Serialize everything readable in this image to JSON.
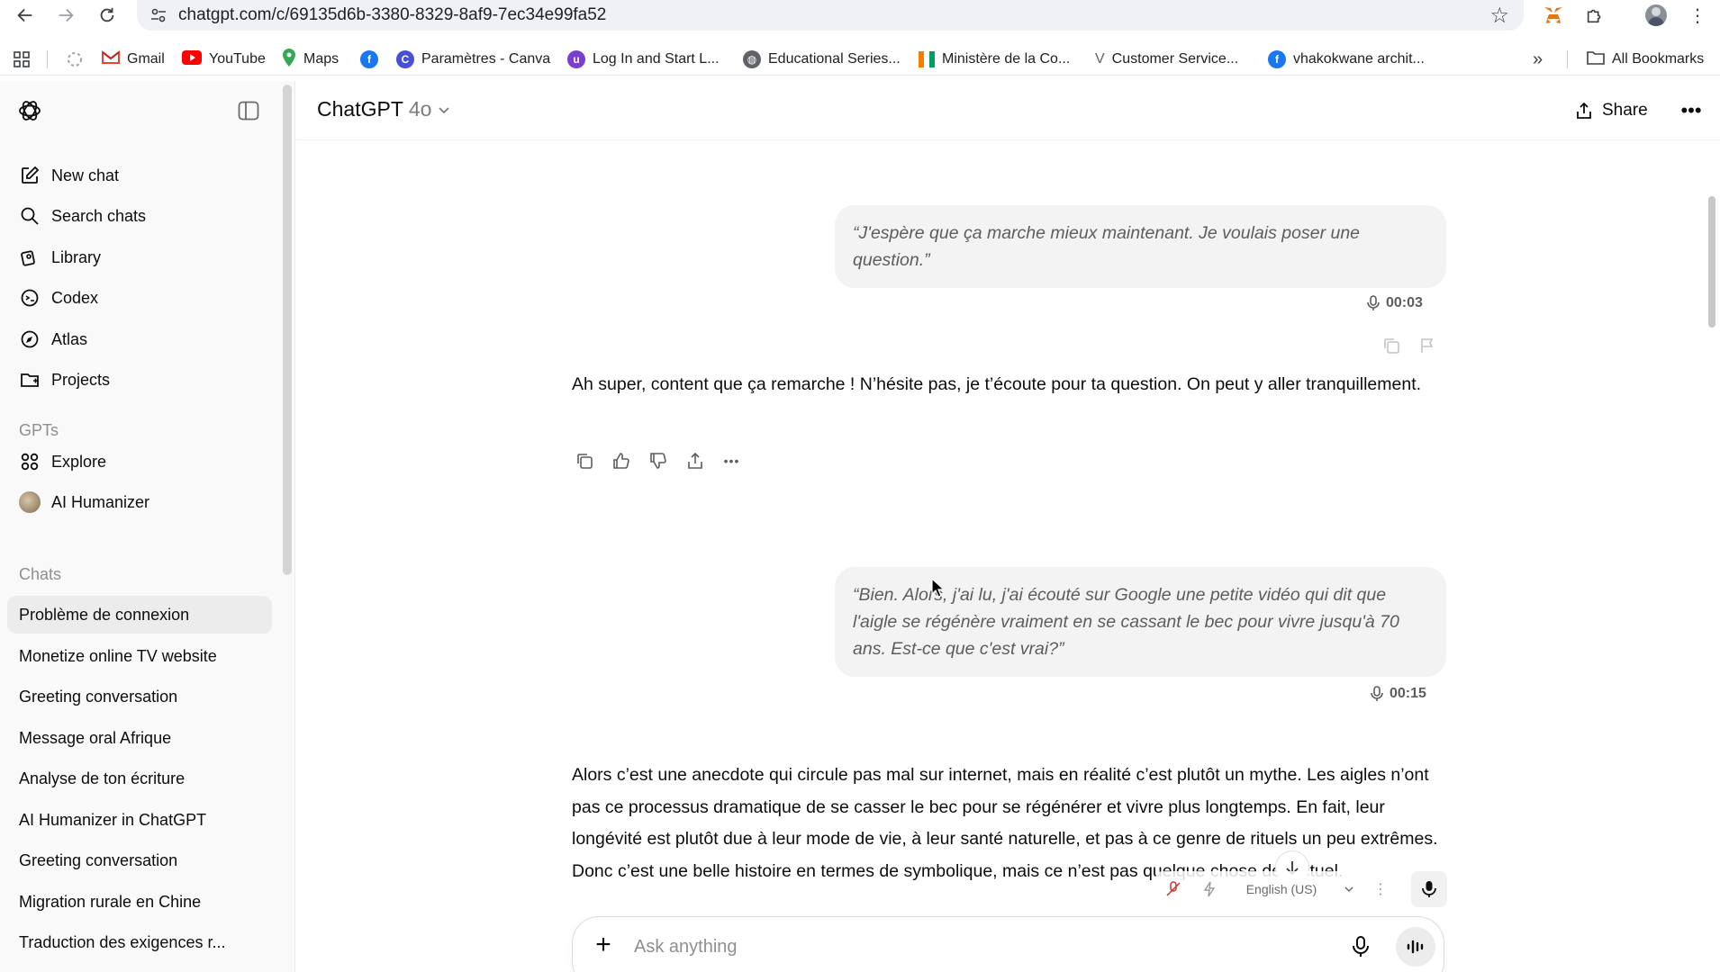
{
  "browser": {
    "url": "chatgpt.com/c/69135d6b-3380-8329-8af9-7ec34e99fa52",
    "bookmarks": [
      {
        "label": "Gmail",
        "icon": "gmail-icon"
      },
      {
        "label": "YouTube",
        "icon": "youtube-icon"
      },
      {
        "label": "Maps",
        "icon": "maps-icon"
      },
      {
        "label": "",
        "icon": "facebook-icon"
      },
      {
        "label": "Paramètres - Canva",
        "icon": "canva-icon"
      },
      {
        "label": "Log In and Start L...",
        "icon": "udemy-icon"
      },
      {
        "label": "Educational Series...",
        "icon": "globe-icon"
      },
      {
        "label": "Ministère de la Co...",
        "icon": "flag-icon"
      },
      {
        "label": "Customer Service...",
        "icon": "v-icon"
      },
      {
        "label": "vhakokwane archit...",
        "icon": "facebook-icon"
      }
    ],
    "all_bookmarks": "All Bookmarks"
  },
  "sidebar": {
    "nav": [
      {
        "label": "New chat",
        "icon": "compose-icon"
      },
      {
        "label": "Search chats",
        "icon": "search-icon"
      },
      {
        "label": "Library",
        "icon": "library-icon"
      },
      {
        "label": "Codex",
        "icon": "codex-icon"
      },
      {
        "label": "Atlas",
        "icon": "atlas-icon"
      },
      {
        "label": "Projects",
        "icon": "folder-icon"
      }
    ],
    "gpts_heading": "GPTs",
    "gpts": [
      {
        "label": "Explore",
        "icon": "grid-icon"
      },
      {
        "label": "AI Humanizer",
        "icon": "avatar-icon"
      }
    ],
    "chats_heading": "Chats",
    "chats": [
      "Problème de connexion",
      "Monetize online TV website",
      "Greeting conversation",
      "Message oral Afrique",
      "Analyse de ton écriture",
      "AI Humanizer in ChatGPT",
      "Greeting conversation",
      "Migration rurale en Chine",
      "Traduction des exigences r..."
    ],
    "active_chat_index": 0
  },
  "header": {
    "model": "ChatGPT",
    "model_version": "4o",
    "share_label": "Share"
  },
  "conversation": {
    "user_1": {
      "text": "“J'espère que ça marche mieux maintenant. Je voulais poser une question.”",
      "duration": "00:03"
    },
    "assistant_1": "Ah super, content que ça remarche ! N’hésite pas, je t’écoute pour ta question. On peut y aller tranquillement.",
    "user_2": {
      "text": "“Bien. Alors, j'ai lu, j'ai écouté sur Google une petite vidéo qui dit que l'aigle se régénère vraiment en se cassant le bec pour vivre jusqu'à 70 ans. Est-ce que c'est vrai?”",
      "duration": "00:15"
    },
    "assistant_2": "Alors c’est une anecdote qui circule pas mal sur internet, mais en réalité c’est plutôt un mythe. Les aigles n’ont pas ce processus dramatique de se casser le bec pour se régénérer et vivre plus longtemps. En fait, leur longévité est plutôt due à leur mode de vie, à leur santé naturelle, et pas à ce genre de rituels un peu extrêmes. Donc c’est une belle histoire en termes de symbolique, mais ce n’est pas quelque chose de factuel."
  },
  "dictation": {
    "language": "English (US)"
  },
  "composer": {
    "placeholder": "Ask anything"
  },
  "colors": {
    "sidebar_bg": "#f9f9f9",
    "bubble_bg": "#f3f3f3",
    "active_chat_bg": "#ececec",
    "text": "#0d0d0d"
  }
}
